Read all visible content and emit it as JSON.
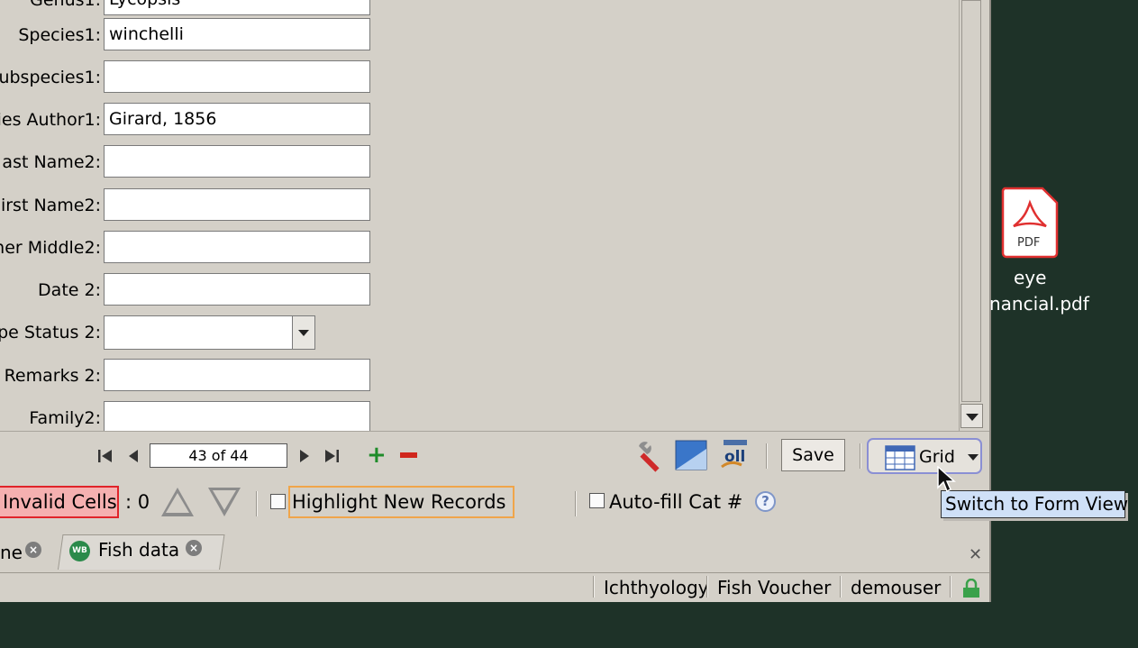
{
  "form": {
    "top_partial_label": "Genus1:",
    "top_partial_value": "Lycopsis",
    "fields": [
      {
        "label": "Species1:",
        "value": "winchelli"
      },
      {
        "label": "ubspecies1:",
        "value": ""
      },
      {
        "label": "ies Author1:",
        "value": "Girard, 1856"
      },
      {
        "label": "ast Name2:",
        "value": ""
      },
      {
        "label": "irst Name2:",
        "value": ""
      },
      {
        "label": "her Middle2:",
        "value": ""
      },
      {
        "label": "Date 2:",
        "value": ""
      },
      {
        "label": "pe Status 2:",
        "value": ""
      },
      {
        "label": "Remarks 2:",
        "value": ""
      },
      {
        "label": "Family2:",
        "value": ""
      }
    ]
  },
  "navigation": {
    "record_indicator": "43 of 44",
    "save_label": "Save",
    "view_label": "Grid"
  },
  "validation": {
    "invalid_cells_label": "Invalid Cells",
    "invalid_count": ": 0",
    "highlight_label": "Highlight New Records",
    "autofill_label": "Auto-fill Cat #",
    "help_glyph": "?"
  },
  "tabs": [
    {
      "label": "ne"
    },
    {
      "label": "Fish data"
    }
  ],
  "status_bar": {
    "discipline": "Ichthyology",
    "collection": "Fish Voucher",
    "user": "demouser"
  },
  "desktop": {
    "pdf_badge": "PDF",
    "file_name_line1": "eye",
    "file_name_line2": "nancial.pdf"
  },
  "tooltip": "Switch to Form View",
  "colors": {
    "desktop_bg": "#1e3228",
    "panel_bg": "#d4d0c8",
    "invalid_fill": "#f5b0b0",
    "invalid_border": "#e0242a",
    "highlight_border": "#f0a54a",
    "tooltip_bg": "#cfe0f7",
    "add_green": "#1f8c2a",
    "delete_red": "#d0271d"
  }
}
